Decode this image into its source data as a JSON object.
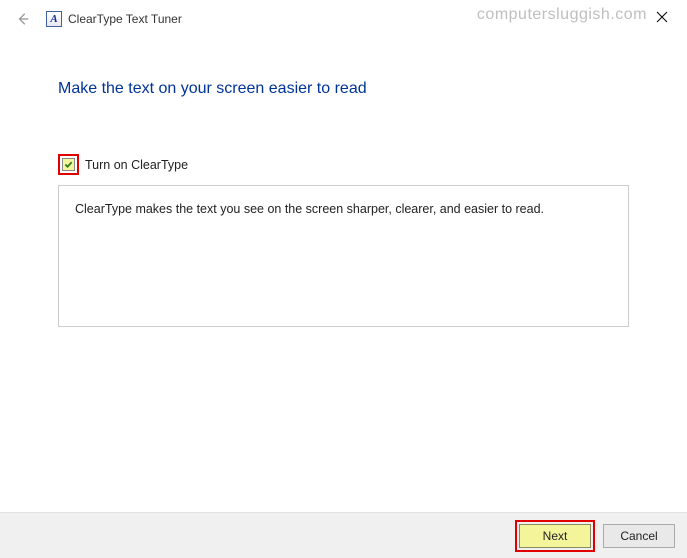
{
  "watermark": "computersluggish.com",
  "window": {
    "title": "ClearType Text Tuner",
    "app_icon_letter": "A"
  },
  "main": {
    "heading": "Make the text on your screen easier to read",
    "checkbox_label": "Turn on ClearType",
    "checkbox_checked": true,
    "description": "ClearType makes the text you see on the screen sharper, clearer, and easier to read."
  },
  "footer": {
    "next_label": "Next",
    "cancel_label": "Cancel"
  }
}
